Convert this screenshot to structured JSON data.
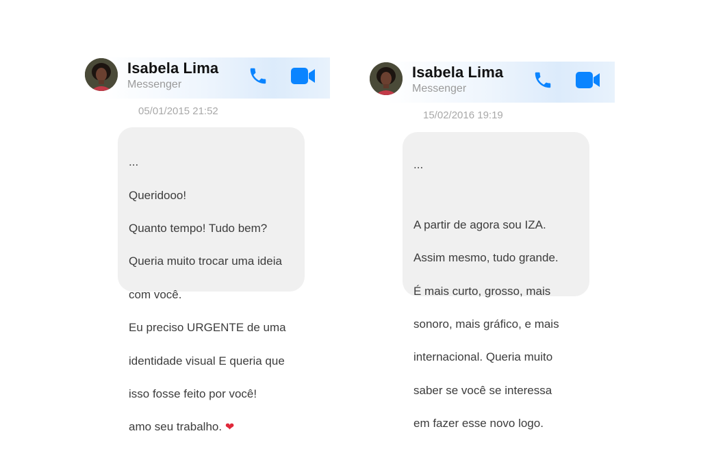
{
  "accent_color": "#0a84ff",
  "conversations": [
    {
      "contact_name": "Isabela Lima",
      "platform": "Messenger",
      "icons": {
        "call": "phone-icon",
        "video": "video-camera-icon"
      },
      "timestamp": "05/01/2015 21:52",
      "message_lines": [
        "...",
        "Queridooo!",
        "Quanto tempo! Tudo bem?",
        "Queria muito trocar uma ideia",
        "com você.",
        "Eu preciso URGENTE de uma",
        "identidade visual E queria que",
        "isso fosse feito por você!",
        "amo seu trabalho."
      ],
      "emoji": "❤"
    },
    {
      "contact_name": "Isabela Lima",
      "platform": "Messenger",
      "icons": {
        "call": "phone-icon",
        "video": "video-camera-icon"
      },
      "timestamp": "15/02/2016 19:19",
      "message_lines": [
        "...",
        "",
        "A partir de agora sou IZA.",
        "Assim mesmo, tudo grande.",
        "É mais curto, grosso, mais",
        "sonoro, mais gráfico, e mais",
        "internacional. Queria muito",
        "saber se você se interessa",
        "em fazer esse novo logo."
      ]
    }
  ]
}
